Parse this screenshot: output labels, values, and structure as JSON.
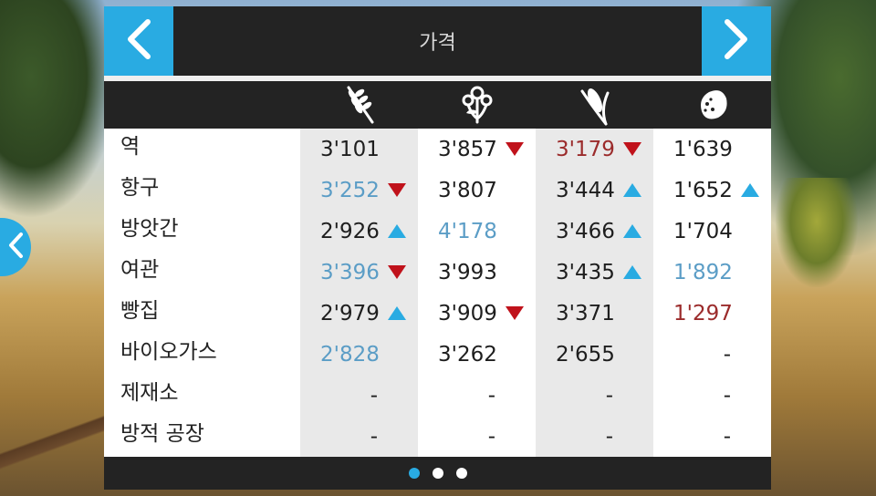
{
  "header": {
    "title": "가격"
  },
  "icons": [
    "wheat-icon",
    "flower-icon",
    "corn-icon",
    "potato-icon"
  ],
  "colors": {
    "accent": "#29abe2",
    "header_bg": "#232323",
    "down": "#c0121b",
    "value_blue": "#5b9dc6",
    "value_red": "#9b2b2b"
  },
  "rows": [
    {
      "label": "역",
      "cells": [
        {
          "value": "3'101",
          "color": "normal",
          "trend": ""
        },
        {
          "value": "3'857",
          "color": "normal",
          "trend": "down"
        },
        {
          "value": "3'179",
          "color": "red",
          "trend": "down"
        },
        {
          "value": "1'639",
          "color": "normal",
          "trend": ""
        }
      ]
    },
    {
      "label": "항구",
      "cells": [
        {
          "value": "3'252",
          "color": "blue",
          "trend": "down"
        },
        {
          "value": "3'807",
          "color": "normal",
          "trend": ""
        },
        {
          "value": "3'444",
          "color": "normal",
          "trend": "up"
        },
        {
          "value": "1'652",
          "color": "normal",
          "trend": "up"
        }
      ]
    },
    {
      "label": "방앗간",
      "cells": [
        {
          "value": "2'926",
          "color": "normal",
          "trend": "up"
        },
        {
          "value": "4'178",
          "color": "blue",
          "trend": ""
        },
        {
          "value": "3'466",
          "color": "normal",
          "trend": "up"
        },
        {
          "value": "1'704",
          "color": "normal",
          "trend": ""
        }
      ]
    },
    {
      "label": "여관",
      "cells": [
        {
          "value": "3'396",
          "color": "blue",
          "trend": "down"
        },
        {
          "value": "3'993",
          "color": "normal",
          "trend": ""
        },
        {
          "value": "3'435",
          "color": "normal",
          "trend": "up"
        },
        {
          "value": "1'892",
          "color": "blue",
          "trend": ""
        }
      ]
    },
    {
      "label": "빵집",
      "cells": [
        {
          "value": "2'979",
          "color": "normal",
          "trend": "up"
        },
        {
          "value": "3'909",
          "color": "normal",
          "trend": "down"
        },
        {
          "value": "3'371",
          "color": "normal",
          "trend": ""
        },
        {
          "value": "1'297",
          "color": "red",
          "trend": ""
        }
      ]
    },
    {
      "label": "바이오가스",
      "cells": [
        {
          "value": "2'828",
          "color": "blue",
          "trend": ""
        },
        {
          "value": "3'262",
          "color": "normal",
          "trend": ""
        },
        {
          "value": "2'655",
          "color": "normal",
          "trend": ""
        },
        {
          "value": "-",
          "color": "dash",
          "trend": ""
        }
      ]
    },
    {
      "label": "제재소",
      "cells": [
        {
          "value": "-",
          "color": "dash",
          "trend": ""
        },
        {
          "value": "-",
          "color": "dash",
          "trend": ""
        },
        {
          "value": "-",
          "color": "dash",
          "trend": ""
        },
        {
          "value": "-",
          "color": "dash",
          "trend": ""
        }
      ]
    },
    {
      "label": "방적 공장",
      "cells": [
        {
          "value": "-",
          "color": "dash",
          "trend": ""
        },
        {
          "value": "-",
          "color": "dash",
          "trend": ""
        },
        {
          "value": "-",
          "color": "dash",
          "trend": ""
        },
        {
          "value": "-",
          "color": "dash",
          "trend": ""
        }
      ]
    }
  ],
  "pagination": {
    "pages": 3,
    "active": 0
  }
}
